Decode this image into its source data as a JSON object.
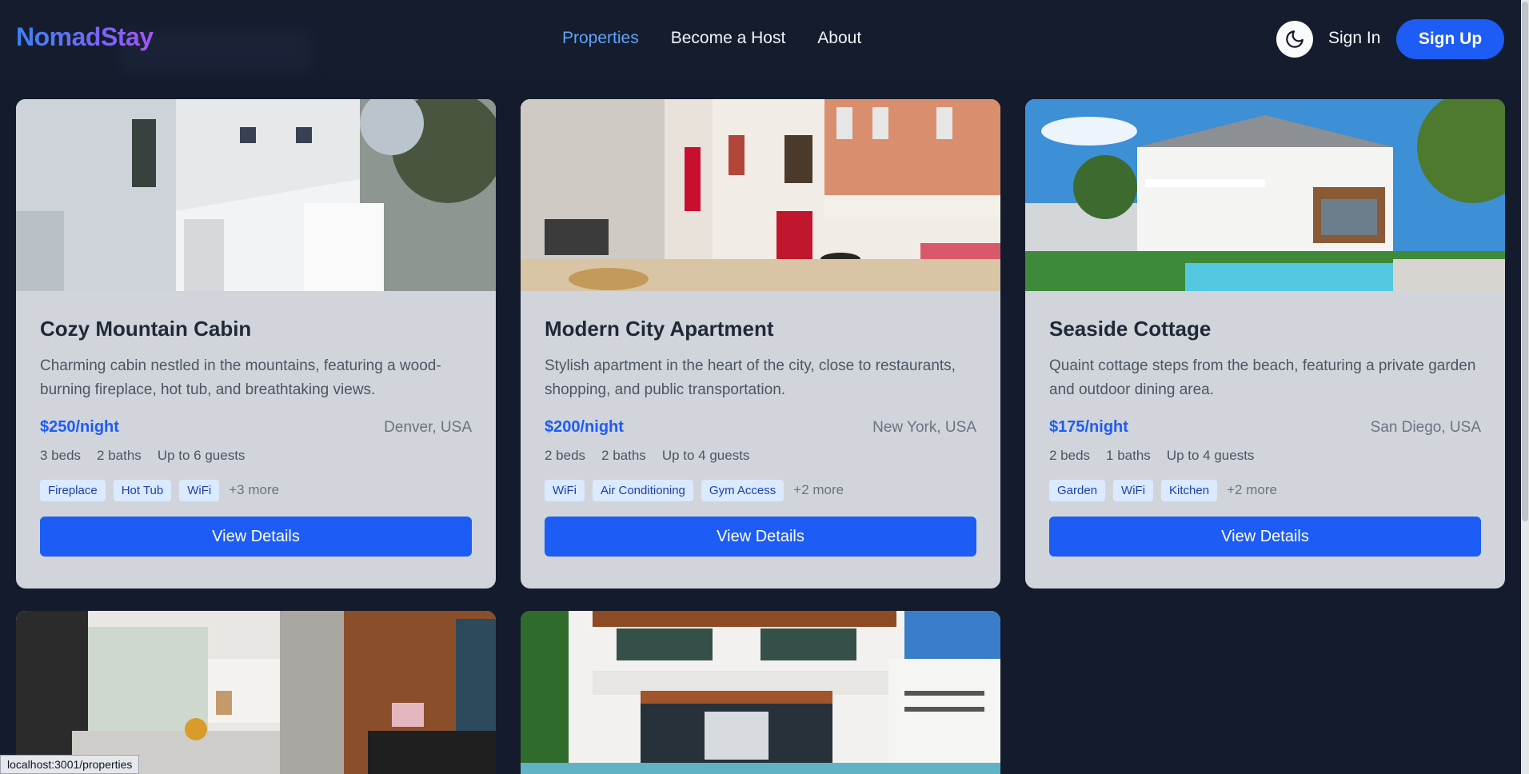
{
  "brand": "NomadStay",
  "nav": {
    "links": [
      {
        "label": "Properties",
        "active": true
      },
      {
        "label": "Become a Host",
        "active": false
      },
      {
        "label": "About",
        "active": false
      }
    ],
    "theme_icon": "moon-icon",
    "signin": "Sign In",
    "signup": "Sign Up"
  },
  "properties": [
    {
      "title": "Cozy Mountain Cabin",
      "description": "Charming cabin nestled in the mountains, featuring a wood-burning fireplace, hot tub, and breathtaking views.",
      "price": "$250/night",
      "location": "Denver, USA",
      "beds": "3 beds",
      "baths": "2 baths",
      "guests": "Up to 6 guests",
      "tags": [
        "Fireplace",
        "Hot Tub",
        "WiFi"
      ],
      "more": "+3 more",
      "button": "View Details"
    },
    {
      "title": "Modern City Apartment",
      "description": "Stylish apartment in the heart of the city, close to restaurants, shopping, and public transportation.",
      "price": "$200/night",
      "location": "New York, USA",
      "beds": "2 beds",
      "baths": "2 baths",
      "guests": "Up to 4 guests",
      "tags": [
        "WiFi",
        "Air Conditioning",
        "Gym Access"
      ],
      "more": "+2 more",
      "button": "View Details"
    },
    {
      "title": "Seaside Cottage",
      "description": "Quaint cottage steps from the beach, featuring a private garden and outdoor dining area.",
      "price": "$175/night",
      "location": "San Diego, USA",
      "beds": "2 beds",
      "baths": "1 baths",
      "guests": "Up to 4 guests",
      "tags": [
        "Garden",
        "WiFi",
        "Kitchen"
      ],
      "more": "+2 more",
      "button": "View Details"
    }
  ],
  "status_url": "localhost:3001/properties",
  "colors": {
    "background": "#131b2c",
    "card": "#d1d5db",
    "accent": "#1d5cf5",
    "active_link": "#60a5fa"
  }
}
